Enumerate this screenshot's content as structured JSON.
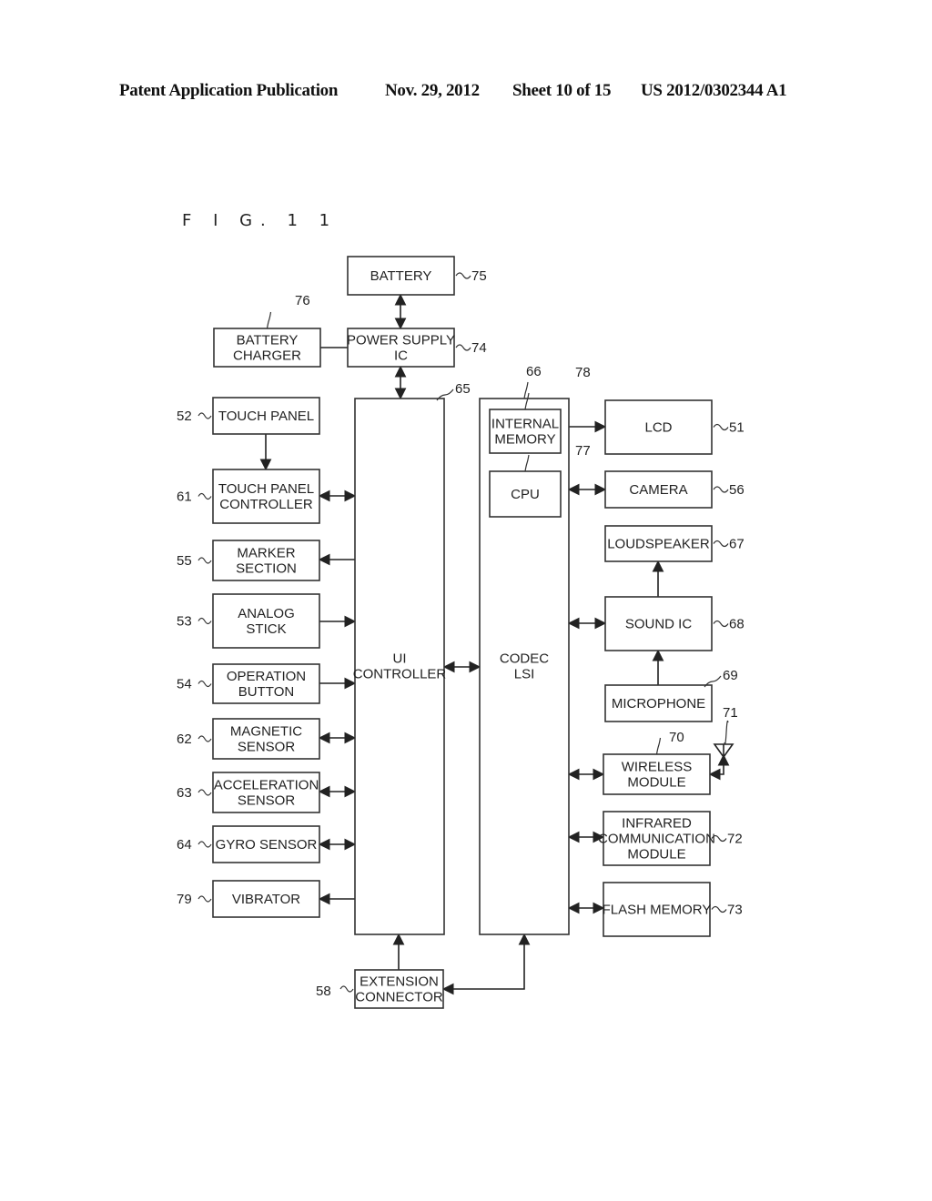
{
  "header": {
    "publication": "Patent Application Publication",
    "date": "Nov. 29, 2012",
    "sheet": "Sheet 10 of 15",
    "number": "US 2012/0302344 A1"
  },
  "figure": {
    "label": "F I G. 1 1",
    "blocks": {
      "battery": {
        "lines": [
          "BATTERY"
        ],
        "ref": "75"
      },
      "battery_charger": {
        "lines": [
          "BATTERY",
          "CHARGER"
        ],
        "ref": "76"
      },
      "power_supply_ic": {
        "lines": [
          "POWER SUPPLY",
          "IC"
        ],
        "ref": "74"
      },
      "ui_controller": {
        "lines": [
          "UI",
          "CONTROLLER"
        ],
        "ref": "65"
      },
      "codec_lsi": {
        "lines": [
          "CODEC",
          "LSI"
        ],
        "ref": "66"
      },
      "internal_memory": {
        "lines": [
          "INTERNAL",
          "MEMORY"
        ],
        "ref": "78"
      },
      "cpu": {
        "lines": [
          "CPU"
        ],
        "ref": "77"
      },
      "touch_panel": {
        "lines": [
          "TOUCH PANEL"
        ],
        "ref": "52"
      },
      "touch_panel_controller": {
        "lines": [
          "TOUCH PANEL",
          "CONTROLLER"
        ],
        "ref": "61"
      },
      "marker_section": {
        "lines": [
          "MARKER",
          "SECTION"
        ],
        "ref": "55"
      },
      "analog_stick": {
        "lines": [
          "ANALOG",
          "STICK"
        ],
        "ref": "53"
      },
      "operation_button": {
        "lines": [
          "OPERATION",
          "BUTTON"
        ],
        "ref": "54"
      },
      "magnetic_sensor": {
        "lines": [
          "MAGNETIC",
          "SENSOR"
        ],
        "ref": "62"
      },
      "acceleration_sensor": {
        "lines": [
          "ACCELERATION",
          "SENSOR"
        ],
        "ref": "63"
      },
      "gyro_sensor": {
        "lines": [
          "GYRO SENSOR"
        ],
        "ref": "64"
      },
      "vibrator": {
        "lines": [
          "VIBRATOR"
        ],
        "ref": "79"
      },
      "lcd": {
        "lines": [
          "LCD"
        ],
        "ref": "51"
      },
      "camera": {
        "lines": [
          "CAMERA"
        ],
        "ref": "56"
      },
      "loudspeaker": {
        "lines": [
          "LOUDSPEAKER"
        ],
        "ref": "67"
      },
      "sound_ic": {
        "lines": [
          "SOUND IC"
        ],
        "ref": "68"
      },
      "microphone": {
        "lines": [
          "MICROPHONE"
        ],
        "ref": "69"
      },
      "wireless_module": {
        "lines": [
          "WIRELESS",
          "MODULE"
        ],
        "ref": "70"
      },
      "antenna": {
        "lines": [],
        "ref": "71"
      },
      "infrared_module": {
        "lines": [
          "INFRARED",
          "COMMUNICATION",
          "MODULE"
        ],
        "ref": "72"
      },
      "flash_memory": {
        "lines": [
          "FLASH MEMORY"
        ],
        "ref": "73"
      },
      "extension_connector": {
        "lines": [
          "EXTENSION",
          "CONNECTOR"
        ],
        "ref": "58"
      }
    }
  }
}
